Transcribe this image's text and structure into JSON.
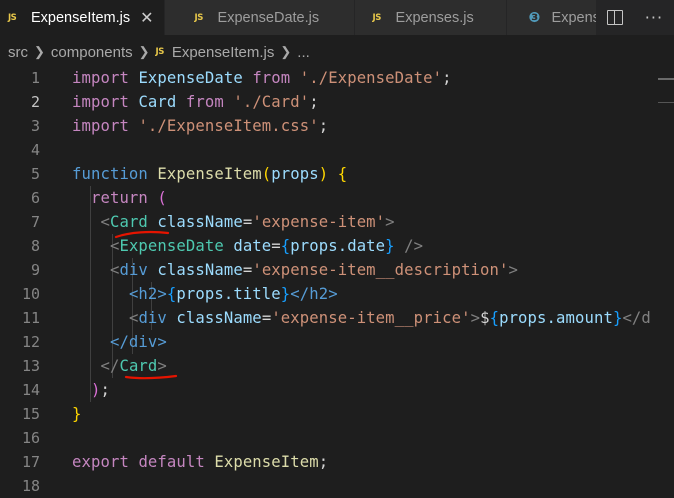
{
  "tabs": [
    {
      "icon": "JS",
      "label": "ExpenseItem.js",
      "active": true,
      "close": "✕"
    },
    {
      "icon": "JS",
      "label": "ExpenseDate.js",
      "active": false
    },
    {
      "icon": "JS",
      "label": "Expenses.js",
      "active": false
    },
    {
      "icon": "css",
      "label": "Expens",
      "active": false
    }
  ],
  "breadcrumb": {
    "folder1": "src",
    "folder2": "components",
    "file_icon": "JS",
    "file": "ExpenseItem.js",
    "ellipsis": "..."
  },
  "editor": {
    "current_line": 2,
    "line_numbers": [
      "1",
      "2",
      "3",
      "4",
      "5",
      "6",
      "7",
      "8",
      "9",
      "10",
      "11",
      "12",
      "13",
      "14",
      "15",
      "16",
      "17",
      "18"
    ],
    "code": {
      "l1": {
        "import": "import",
        "name": "ExpenseDate",
        "from": "from",
        "path": "'./ExpenseDate'",
        "semi": ";"
      },
      "l2": {
        "import": "import",
        "name": "Card",
        "from": "from",
        "path": "'./Card'",
        "semi": ";"
      },
      "l3": {
        "import": "import",
        "path": "'./ExpenseItem.css'",
        "semi": ";"
      },
      "l5": {
        "function": "function",
        "name": "ExpenseItem",
        "open": "(",
        "param": "props",
        "close": ")",
        "brace": "{"
      },
      "l6": {
        "return": "return",
        "paren": "("
      },
      "l7": {
        "lt": "<",
        "tag": "Card",
        "attr": "className",
        "eq": "=",
        "val": "'expense-item'",
        "gt": ">"
      },
      "l8": {
        "lt": "<",
        "tag": "ExpenseDate",
        "attr": "date",
        "eq": "=",
        "bopen": "{",
        "expr": "props.date",
        "bclose": "}",
        "end": " />"
      },
      "l9": {
        "lt": "<",
        "tag": "div",
        "attr": "className",
        "eq": "=",
        "val": "'expense-item__description'",
        "gt": ">"
      },
      "l10": {
        "open": "<h2>",
        "bopen": "{",
        "expr": "props.title",
        "bclose": "}",
        "close": "</h2>"
      },
      "l11": {
        "lt": "<",
        "tag": "div",
        "attr": "className",
        "eq": "=",
        "val": "'expense-item__price'",
        "gt": ">",
        "dollar": "$",
        "bopen": "{",
        "expr": "props.amount",
        "bclose": "}",
        "tail": "</d"
      },
      "l12": {
        "close": "</div>"
      },
      "l13": {
        "lt": "</",
        "tag": "Card",
        "gt": ">"
      },
      "l14": {
        "paren": ")",
        "semi": ";"
      },
      "l15": {
        "brace": "}"
      },
      "l17": {
        "export": "export",
        "default": "default",
        "name": "ExpenseItem",
        "semi": ";"
      }
    }
  },
  "colors": {
    "background": "#1e1e1e",
    "tabbar": "#252526",
    "annotation": "#e51400"
  },
  "icons": [
    "js-file-icon",
    "css-file-icon",
    "close-icon",
    "split-editor-icon",
    "more-actions-icon",
    "chevron-right-icon"
  ]
}
